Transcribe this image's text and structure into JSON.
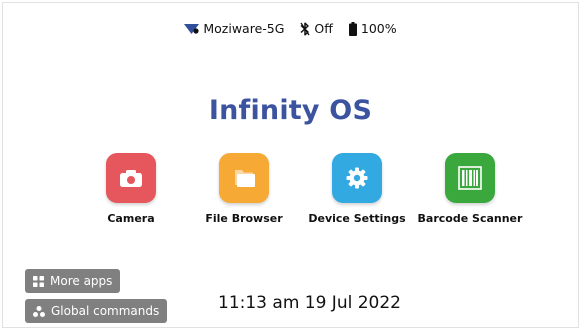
{
  "status_bar": {
    "wifi_name": "Moziware-5G",
    "bluetooth_state": "Off",
    "battery_level": "100%",
    "icons": [
      "wifi-icon",
      "bluetooth-icon",
      "battery-icon"
    ]
  },
  "title": "Infinity OS",
  "apps": [
    {
      "label": "Camera",
      "icon": "camera-icon",
      "color": "#e5575c"
    },
    {
      "label": "File Browser",
      "icon": "folder-icon",
      "color": "#f6a934"
    },
    {
      "label": "Device Settings",
      "icon": "gear-icon",
      "color": "#33a9e2"
    },
    {
      "label": "Barcode Scanner",
      "icon": "barcode-icon",
      "color": "#3aa83d"
    }
  ],
  "buttons": {
    "more_apps": {
      "label": "More apps",
      "icon": "grid-icon"
    },
    "global_commands": {
      "label": "Global commands",
      "icon": "nodes-icon"
    }
  },
  "datetime": "11:13 am 19 Jul 2022",
  "colors": {
    "title": "#3c53a0",
    "button_bg": "#808080"
  }
}
